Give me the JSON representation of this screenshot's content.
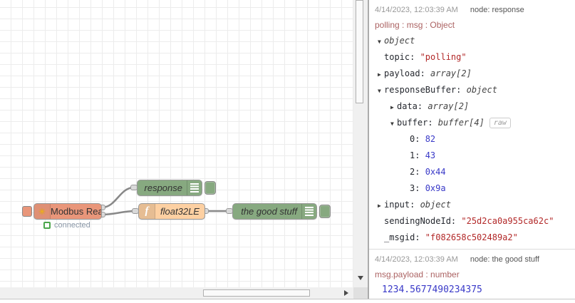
{
  "canvas": {
    "wire_color": "#888888",
    "nodes": {
      "modbus_read": {
        "label": "Modbus Read",
        "color": "#E9967A",
        "icon": "modbus-asterisk-icon",
        "status_text": "connected",
        "status_color": "#4ca64c"
      },
      "response": {
        "label": "response",
        "color": "#87A980",
        "icon": "debug-lines-icon"
      },
      "float32le": {
        "label": "float32LE",
        "color": "#FDD0A2",
        "icon": "function-f-icon"
      },
      "the_good_stuff": {
        "label": "the good stuff",
        "color": "#87A980",
        "icon": "debug-lines-icon"
      }
    }
  },
  "sidebar": {
    "raw_button_label": "raw",
    "value_colors": {
      "string": "#b22828",
      "number": "#3a3ac8",
      "meta": "#ac6363"
    },
    "messages": [
      {
        "timestamp": "4/14/2023, 12:03:39 AM",
        "node_label": "node: response",
        "meta": "polling : msg : Object",
        "tree": [
          {
            "indent": 0,
            "caret": "down",
            "root": true,
            "value": "object",
            "type": "type"
          },
          {
            "indent": 0,
            "caret": "",
            "key": "topic",
            "value": "\"polling\"",
            "type": "string"
          },
          {
            "indent": 0,
            "caret": "right",
            "key": "payload",
            "value": "array[2]",
            "type": "type"
          },
          {
            "indent": 0,
            "caret": "down",
            "key": "responseBuffer",
            "value": "object",
            "type": "type"
          },
          {
            "indent": 1,
            "caret": "right",
            "key": "data",
            "value": "array[2]",
            "type": "type"
          },
          {
            "indent": 1,
            "caret": "down",
            "key": "buffer",
            "value": "buffer[4]",
            "type": "type",
            "raw": true
          },
          {
            "indent": 2,
            "caret": "",
            "key": "0",
            "value": "82",
            "type": "number"
          },
          {
            "indent": 2,
            "caret": "",
            "key": "1",
            "value": "43",
            "type": "number"
          },
          {
            "indent": 2,
            "caret": "",
            "key": "2",
            "value": "0x44",
            "type": "number"
          },
          {
            "indent": 2,
            "caret": "",
            "key": "3",
            "value": "0x9a",
            "type": "number"
          },
          {
            "indent": 0,
            "caret": "right",
            "key": "input",
            "value": "object",
            "type": "type"
          },
          {
            "indent": 0,
            "caret": "",
            "key": "sendingNodeId",
            "value": "\"25d2ca0a955ca62c\"",
            "type": "string"
          },
          {
            "indent": 0,
            "caret": "",
            "key": "_msgid",
            "value": "\"f082658c502489a2\"",
            "type": "string"
          }
        ]
      },
      {
        "timestamp": "4/14/2023, 12:03:39 AM",
        "node_label": "node: the good stuff",
        "meta": "msg.payload : number",
        "value": "1234.5677490234375"
      }
    ]
  }
}
